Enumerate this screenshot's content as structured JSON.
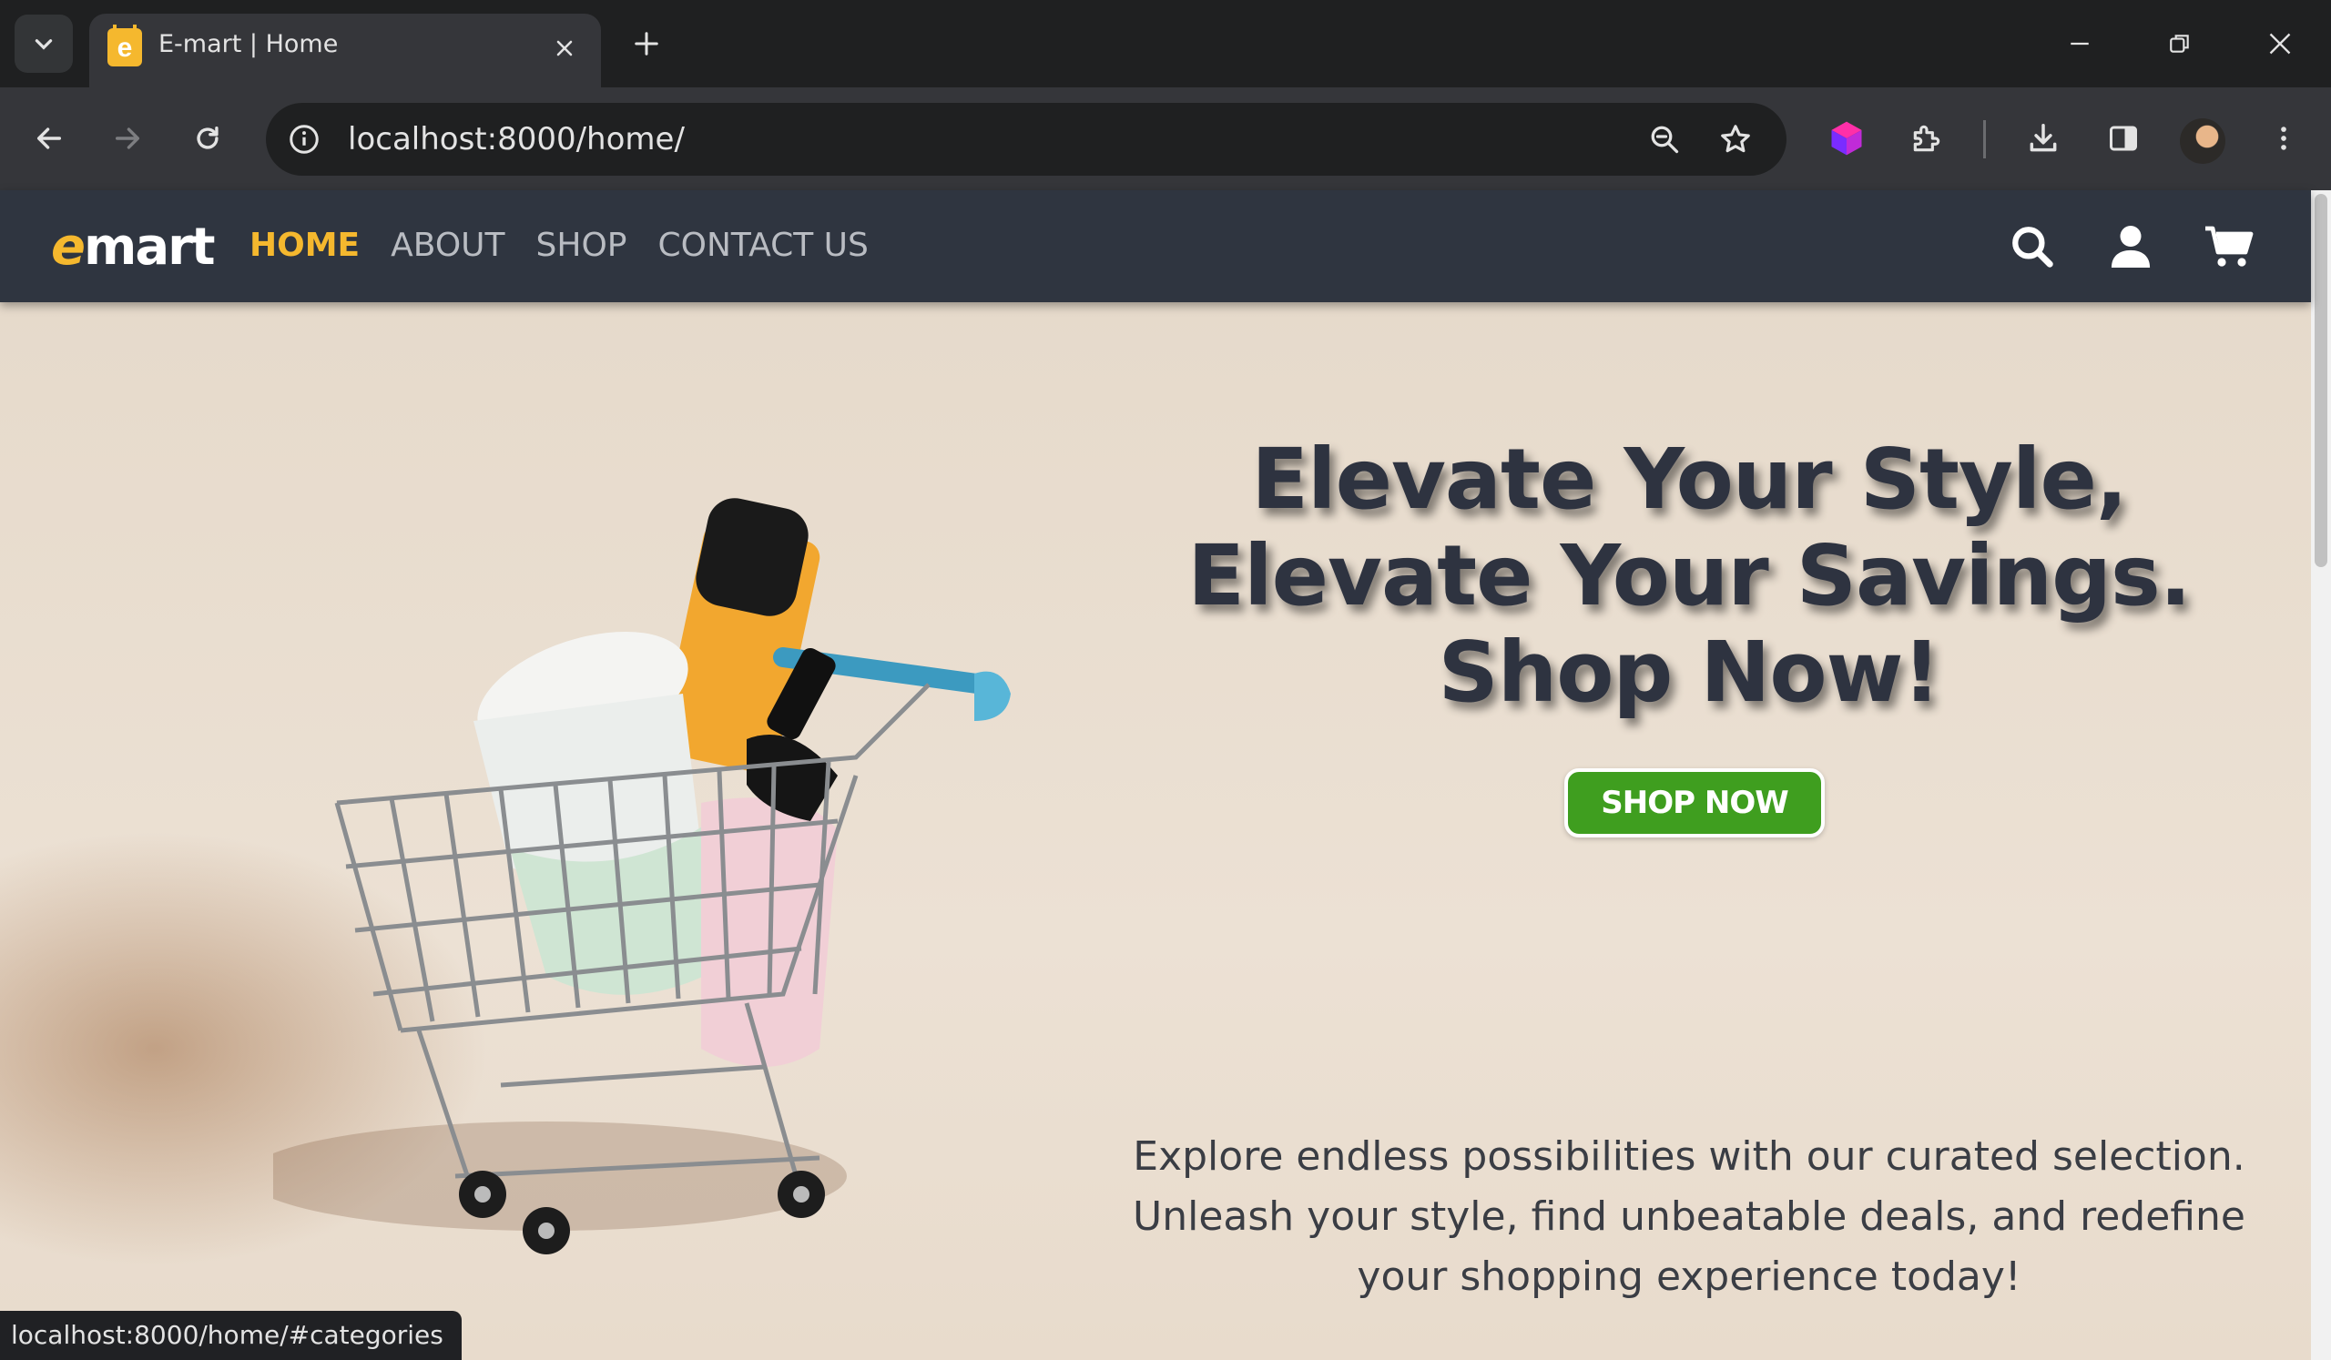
{
  "browser": {
    "tab_title": "E-mart | Home",
    "url": "localhost:8000/home/",
    "status_url": "localhost:8000/home/#categories"
  },
  "site": {
    "logo": {
      "accent": "e",
      "rest": "mart",
      "accent_color": "#f5b82e"
    },
    "nav_links": [
      {
        "label": "HOME",
        "active": true
      },
      {
        "label": "ABOUT",
        "active": false
      },
      {
        "label": "SHOP",
        "active": false
      },
      {
        "label": "CONTACT US",
        "active": false
      }
    ],
    "nav_icons": [
      "search-icon",
      "user-icon",
      "cart-icon"
    ],
    "nav_bg": "#2f3540",
    "active_color": "#f5b82e"
  },
  "hero": {
    "title": "Elevate Your Style, Elevate Your Savings. Shop Now!",
    "button_label": "SHOP NOW",
    "button_color": "#3f9e1f",
    "description": "Explore endless possibilities with our curated selection. Unleash your style, find unbeatable deals, and redefine your shopping experience today!"
  }
}
